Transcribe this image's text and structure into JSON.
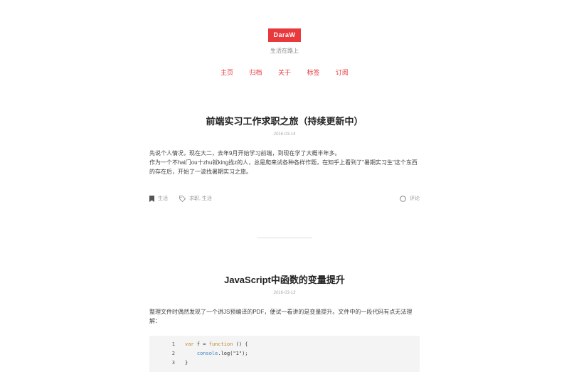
{
  "site": {
    "brand": "DaraW",
    "tagline": "生活在路上"
  },
  "nav": {
    "home": "主页",
    "archive": "归档",
    "about": "关于",
    "tags": "标签",
    "subscribe": "订阅"
  },
  "posts": [
    {
      "title": "前端实习工作求职之旅（持续更新中）",
      "date": "2016-03-14",
      "body": [
        "先说个人情况，现在大二，去年9月开始学习前端，到现在学了大概半年多。",
        "作为一个不hai门ou十zhu就king找z的人，总是爬来试各种各样作题，在知乎上看到了\"暑期实习生\"这个东西的存在后，开始了一波找暑期实习之旅。"
      ],
      "category": "生活",
      "tags": "求职, 生活",
      "comments": "评论"
    },
    {
      "title": "JavaScript中函数的变量提升",
      "date": "2016-03-13",
      "body": [
        "整理文件时偶然发现了一个讲JS预编译的PDF，便试一看讲的是变量提升。文件中的一段代码有点无法理解："
      ],
      "code": [
        {
          "ln": "1",
          "kw": "var",
          "text": " f = ",
          "kw2": "function",
          "rest": " () {"
        },
        {
          "ln": "2",
          "indent": "    ",
          "fn": "console",
          "rest": ".log(\"1\");"
        },
        {
          "ln": "3",
          "rest": "}"
        }
      ]
    }
  ]
}
